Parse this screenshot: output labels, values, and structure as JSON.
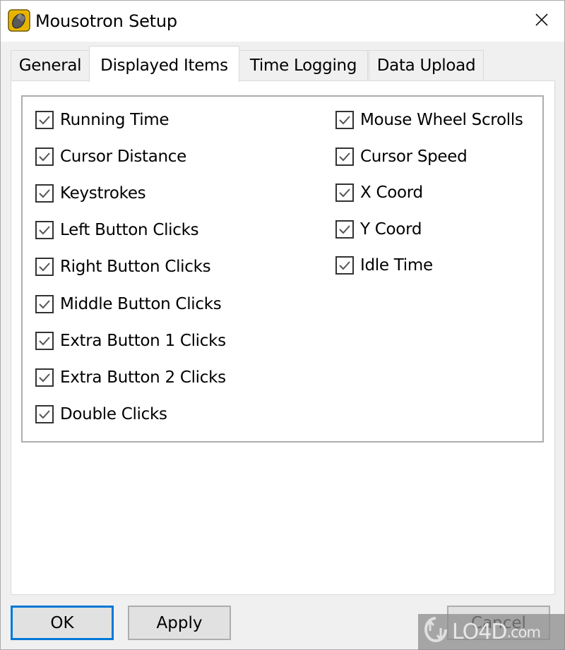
{
  "window": {
    "title": "Mousotron Setup",
    "app_icon": "mousotron-app-icon",
    "close_icon": "close-icon"
  },
  "tabs": [
    {
      "label": "General",
      "active": false
    },
    {
      "label": "Displayed Items",
      "active": true
    },
    {
      "label": "Time Logging",
      "active": false
    },
    {
      "label": "Data Upload",
      "active": false
    }
  ],
  "displayed_items": {
    "left": [
      {
        "label": "Running Time",
        "checked": true
      },
      {
        "label": "Cursor Distance",
        "checked": true
      },
      {
        "label": "Keystrokes",
        "checked": true
      },
      {
        "label": "Left Button Clicks",
        "checked": true
      },
      {
        "label": "Right Button Clicks",
        "checked": true
      },
      {
        "label": "Middle Button Clicks",
        "checked": true
      },
      {
        "label": "Extra Button 1 Clicks",
        "checked": true
      },
      {
        "label": "Extra Button 2 Clicks",
        "checked": true
      },
      {
        "label": "Double Clicks",
        "checked": true
      }
    ],
    "right": [
      {
        "label": "Mouse Wheel Scrolls",
        "checked": true
      },
      {
        "label": "Cursor Speed",
        "checked": true
      },
      {
        "label": "X Coord",
        "checked": true
      },
      {
        "label": "Y Coord",
        "checked": true
      },
      {
        "label": "Idle Time",
        "checked": true
      }
    ]
  },
  "buttons": {
    "ok": "OK",
    "apply": "Apply",
    "cancel": "Cancel"
  },
  "watermark": {
    "brand": "LO4D",
    "suffix": ".com"
  },
  "colors": {
    "focus_border": "#0078d7",
    "app_icon_bg": "#f2c200"
  }
}
